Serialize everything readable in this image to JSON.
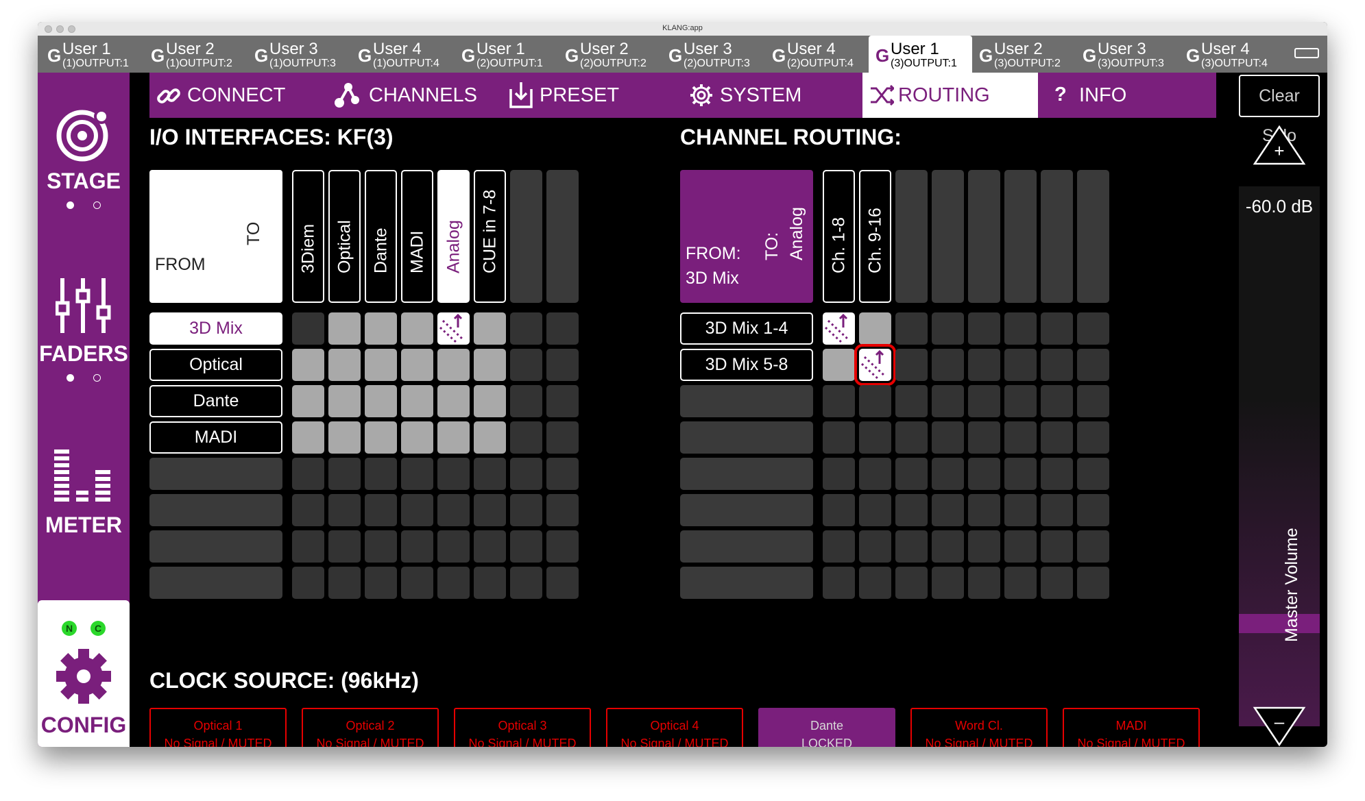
{
  "window_title": "KLANG:app",
  "user_tabs": [
    {
      "name": "User 1",
      "output": "(1)OUTPUT:1",
      "icon": "g-logo-icon"
    },
    {
      "name": "User 2",
      "output": "(1)OUTPUT:2",
      "icon": "g-logo-icon"
    },
    {
      "name": "User 3",
      "output": "(1)OUTPUT:3",
      "icon": "g-logo-icon"
    },
    {
      "name": "User 4",
      "output": "(1)OUTPUT:4",
      "icon": "g-logo-icon"
    },
    {
      "name": "User 1",
      "output": "(2)OUTPUT:1",
      "icon": "g-logo-icon"
    },
    {
      "name": "User 2",
      "output": "(2)OUTPUT:2",
      "icon": "g-logo-icon"
    },
    {
      "name": "User 3",
      "output": "(2)OUTPUT:3",
      "icon": "g-logo-icon"
    },
    {
      "name": "User 4",
      "output": "(2)OUTPUT:4",
      "icon": "g-logo-icon"
    },
    {
      "name": "User 1",
      "output": "(3)OUTPUT:1",
      "icon": "g-logo-icon",
      "active": true
    },
    {
      "name": "User 2",
      "output": "(3)OUTPUT:2",
      "icon": "g-logo-icon"
    },
    {
      "name": "User 3",
      "output": "(3)OUTPUT:3",
      "icon": "g-logo-icon"
    },
    {
      "name": "User 4",
      "output": "(3)OUTPUT:4",
      "icon": "g-logo-icon"
    }
  ],
  "sidebar": {
    "stage": "STAGE",
    "faders": "FADERS",
    "meter": "METER",
    "config": "CONFIG",
    "led_n": "N",
    "led_c": "C"
  },
  "nav": {
    "connect": "CONNECT",
    "channels": "CHANNELS",
    "preset": "PRESET",
    "system": "SYSTEM",
    "routing": "ROUTING",
    "info": "INFO",
    "active": "ROUTING"
  },
  "clear_solo": "Clear Solo",
  "io": {
    "heading": "I/O INTERFACES: KF(3)",
    "corner_from": "FROM",
    "corner_to": "TO",
    "columns": [
      "3Diem",
      "Optical",
      "Dante",
      "MADI",
      "Analog",
      "CUE in 7-8"
    ],
    "selected_column": "Analog",
    "rows": [
      "3D Mix",
      "Optical",
      "Dante",
      "MADI"
    ],
    "selected_row": "3D Mix",
    "matrix": [
      [
        0,
        1,
        1,
        1,
        2,
        1
      ],
      [
        1,
        1,
        1,
        1,
        1,
        1
      ],
      [
        1,
        1,
        1,
        1,
        1,
        1
      ],
      [
        1,
        1,
        1,
        1,
        1,
        1
      ]
    ]
  },
  "channel_routing": {
    "heading": "CHANNEL ROUTING:",
    "corner_from": "FROM:",
    "corner_from_value": "3D Mix",
    "corner_to": "TO:",
    "corner_to_value": "Analog",
    "columns": [
      "Ch. 1-8",
      "Ch. 9-16"
    ],
    "rows": [
      "3D Mix 1-4",
      "3D Mix 5-8"
    ],
    "matrix": [
      [
        2,
        1
      ],
      [
        1,
        2
      ]
    ],
    "highlighted_cell": {
      "row": "3D Mix 5-8",
      "column": "Ch. 9-16"
    }
  },
  "volume": {
    "value_text": "-60.0 dB",
    "label": "Master Volume",
    "up_button": "+",
    "down_button": "–"
  },
  "clock": {
    "heading": "CLOCK SOURCE: (96kHz)",
    "sources": [
      {
        "name": "Optical 1",
        "status": "No Signal / MUTED",
        "locked": false
      },
      {
        "name": "Optical 2",
        "status": "No Signal / MUTED",
        "locked": false
      },
      {
        "name": "Optical 3",
        "status": "No Signal / MUTED",
        "locked": false
      },
      {
        "name": "Optical 4",
        "status": "No Signal / MUTED",
        "locked": false
      },
      {
        "name": "Dante",
        "status": "LOCKED",
        "locked": true
      },
      {
        "name": "Word Cl.",
        "status": "No Signal / MUTED",
        "locked": false
      },
      {
        "name": "MADI",
        "status": "No Signal / MUTED",
        "locked": false
      }
    ]
  },
  "colors": {
    "accent": "#7a1f7c",
    "error": "#e60000",
    "led": "#2bd82b"
  }
}
